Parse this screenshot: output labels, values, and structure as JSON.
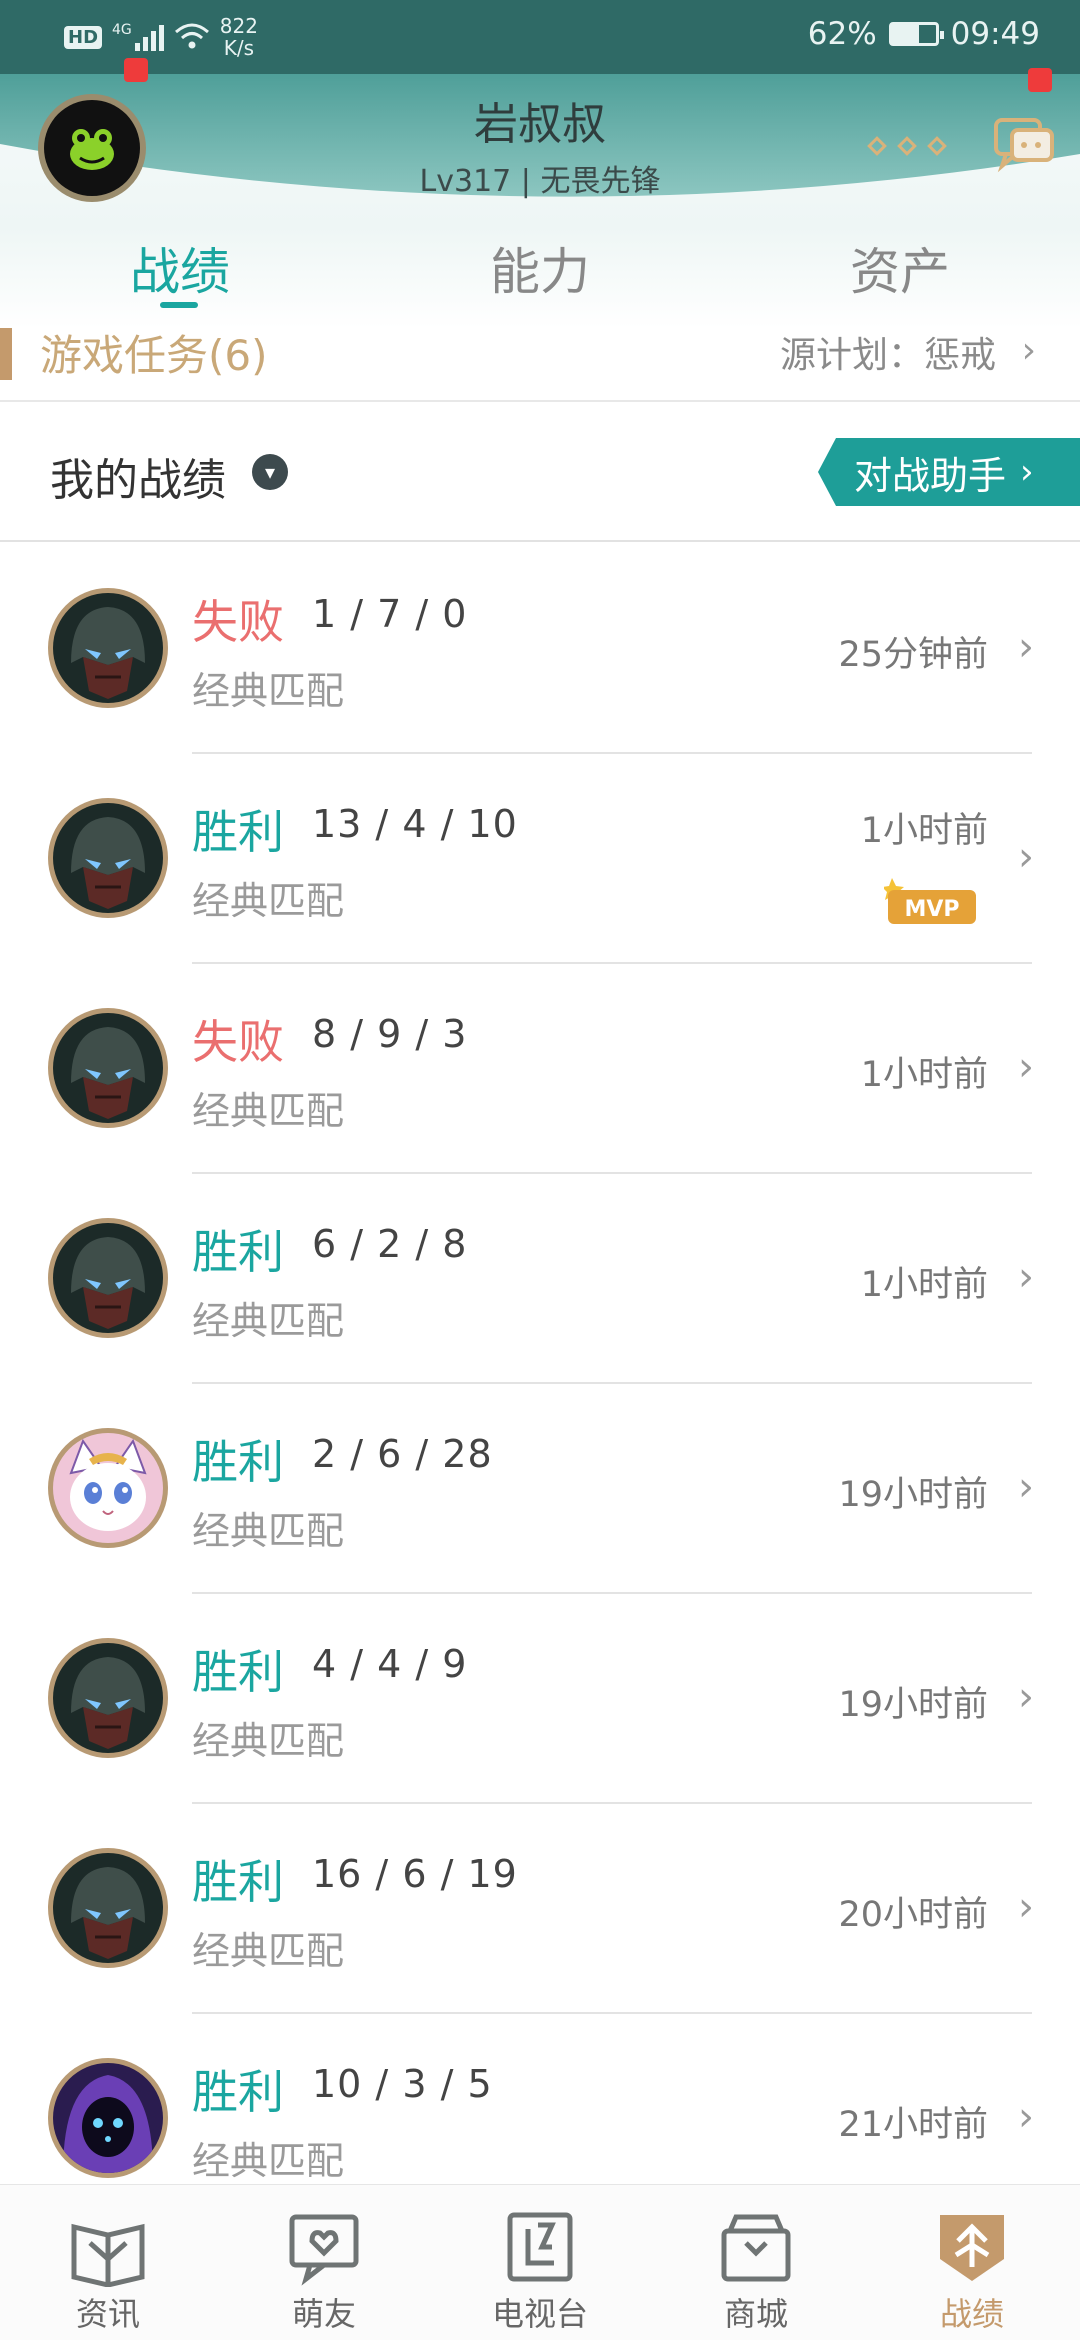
{
  "status_bar": {
    "hd": "HD",
    "network": "4G",
    "speed_value": "822",
    "speed_unit": "K/s",
    "battery": "62%",
    "battery_level": 0.62,
    "time": "09:49"
  },
  "profile": {
    "name": "岩叔叔",
    "subtitle": "Lv317 | 无畏先锋"
  },
  "tabs": [
    {
      "label": "战绩",
      "active": true
    },
    {
      "label": "能力",
      "active": false
    },
    {
      "label": "资产",
      "active": false
    }
  ],
  "task": {
    "title": "游戏任务(6)",
    "right_text": "源计划：惩戒",
    "chevron": "›"
  },
  "records": {
    "title": "我的战绩",
    "assistant_button": "对战助手",
    "chevron": "›"
  },
  "matches": [
    {
      "result": "失败",
      "outcome": "lose",
      "kda": "1 / 7 / 0",
      "mode": "经典匹配",
      "time": "25分钟前",
      "hero": "dark-helmet",
      "mvp": false
    },
    {
      "result": "胜利",
      "outcome": "win",
      "kda": "13 / 4 / 10",
      "mode": "经典匹配",
      "time": "1小时前",
      "hero": "dark-helmet",
      "mvp": true,
      "mvp_label": "MVP"
    },
    {
      "result": "失败",
      "outcome": "lose",
      "kda": "8 / 9 / 3",
      "mode": "经典匹配",
      "time": "1小时前",
      "hero": "dark-helmet",
      "mvp": false
    },
    {
      "result": "胜利",
      "outcome": "win",
      "kda": "6 / 2 / 8",
      "mode": "经典匹配",
      "time": "1小时前",
      "hero": "dark-helmet",
      "mvp": false
    },
    {
      "result": "胜利",
      "outcome": "win",
      "kda": "2 / 6 / 28",
      "mode": "经典匹配",
      "time": "19小时前",
      "hero": "cat-yuumi",
      "mvp": false
    },
    {
      "result": "胜利",
      "outcome": "win",
      "kda": "4 / 4 / 9",
      "mode": "经典匹配",
      "time": "19小时前",
      "hero": "dark-helmet",
      "mvp": false
    },
    {
      "result": "胜利",
      "outcome": "win",
      "kda": "16 / 6 / 19",
      "mode": "经典匹配",
      "time": "20小时前",
      "hero": "dark-helmet",
      "mvp": false
    },
    {
      "result": "胜利",
      "outcome": "win",
      "kda": "10 / 3 / 5",
      "mode": "经典匹配",
      "time": "21小时前",
      "hero": "purple-hood",
      "mvp": false
    }
  ],
  "bottom_nav": [
    {
      "label": "资讯",
      "icon": "news-icon",
      "active": false
    },
    {
      "label": "萌友",
      "icon": "friends-icon",
      "active": false
    },
    {
      "label": "电视台",
      "icon": "tv-icon",
      "active": false
    },
    {
      "label": "商城",
      "icon": "shop-icon",
      "active": false
    },
    {
      "label": "战绩",
      "icon": "records-icon",
      "active": true
    }
  ],
  "colors": {
    "accent": "#1aa6a0",
    "lose": "#ea6f6f",
    "gold": "#c49a6c",
    "status_bar": "#2f6a66"
  }
}
